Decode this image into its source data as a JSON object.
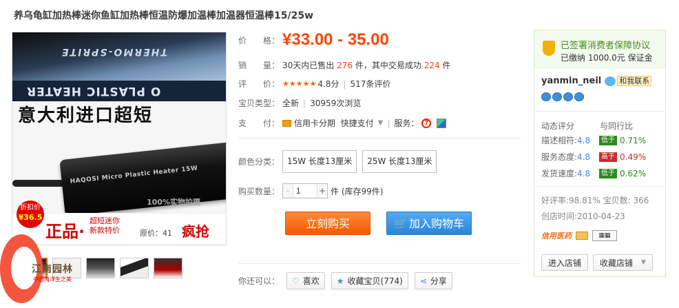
{
  "product": {
    "title": "养乌龟缸加热棒迷你鱼缸加热棒恒温防爆加温棒加温器恒温棒15/25w",
    "image": {
      "banner_text": "THERMO-SPRITE",
      "banner_text2": "O PLASTIC HEATER",
      "headline": "意大利进口超短",
      "heater_label": "HAQOSI  Micro Plastic Heater 15W",
      "watermark": "100%实物拍摄",
      "discount_label": "折扣价",
      "discount_value": "¥36.5",
      "promo_main": "正品·",
      "promo_note1": "超短迷你",
      "promo_note2": "新款特价",
      "orig_label": "原价：41",
      "crazy": "疯抢"
    },
    "thumbnails": [
      "thumb-1",
      "thumb-2",
      "thumb-3",
      "thumb-4",
      "thumb-5"
    ]
  },
  "site_badge": {
    "text": "江南园林",
    "sub": "中国海洋生之美"
  },
  "props": {
    "price_label": "价　　格：",
    "price": "¥33.00 - 35.00",
    "sales_label": "销　　量：",
    "sales_prefix": "30天内已售出",
    "sales_count": "276",
    "sales_mid": "件，其中交易成功",
    "sales_success": "224",
    "sales_suffix": "件",
    "rating_label": "评　　价：",
    "rating_stars": "★★★★★",
    "rating_score": "4.8分",
    "rating_count": "517条评价",
    "type_label": "宝贝类型：",
    "type_value": "全新",
    "views": "30959次浏览",
    "pay_label": "支　　付：",
    "pay_installment": "信用卡分期",
    "pay_quick": "快捷支付",
    "service_label": "服务：",
    "color_label": "颜色分类：",
    "sku": [
      "15W 长度13厘米",
      "25W 长度13厘米"
    ],
    "qty_label": "购买数量：",
    "qty_value": "1",
    "qty_stock": "件 (库存99件)",
    "buy_now": "立刻购买",
    "add_cart": "加入购物车",
    "share_label": "你还可以：",
    "like": "喜欢",
    "favorite": "收藏宝贝(774)",
    "share": "分享"
  },
  "shop": {
    "guarantee": "已签署消费者保障协议",
    "deposit": "已缴纳 1000.0元 保证金",
    "seller": "yanmin_neil",
    "contact": "和我联系",
    "score_header": "动态评分",
    "compare_header": "与同行比",
    "scores": [
      {
        "label": "描述相符:",
        "value": "4.8",
        "level": "低于",
        "pct": "0.71%",
        "kind": "low"
      },
      {
        "label": "服务态度:",
        "value": "4.8",
        "level": "高于",
        "pct": "0.49%",
        "kind": "high"
      },
      {
        "label": "发货速度:",
        "value": "4.8",
        "level": "低于",
        "pct": "0.62%",
        "kind": "low"
      }
    ],
    "good_rate": "好评率:98.81% 宝贝数: 366",
    "created": "创店时间:2010-04-23",
    "xinyong": "信用医药",
    "enter_shop": "进入店铺",
    "fav_shop": "收藏店铺"
  },
  "colors": {
    "price": "#ff4400",
    "buy": "#f05a00",
    "cart": "#2a86d8",
    "guarantee": "#4a8b22"
  }
}
